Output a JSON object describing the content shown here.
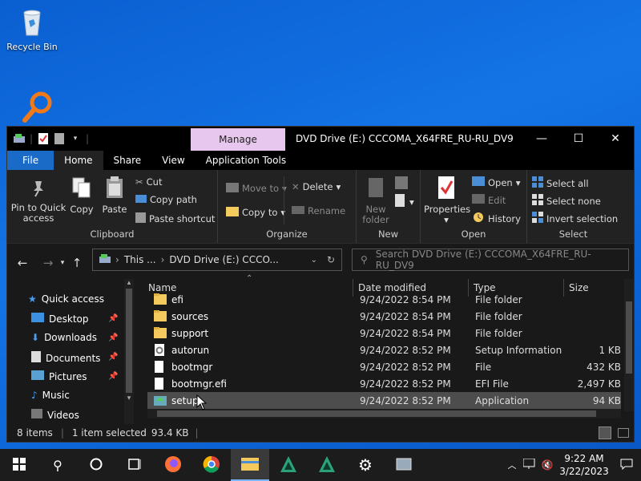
{
  "desktop": {
    "recycle_bin_label": "Recycle Bin"
  },
  "window": {
    "title": "DVD Drive (E:) CCCOMA_X64FRE_RU-RU_DV9",
    "manage_label": "Manage",
    "tabs": [
      "File",
      "Home",
      "Share",
      "View",
      "Application Tools"
    ]
  },
  "ribbon": {
    "clipboard": {
      "pin_label": "Pin to Quick access",
      "copy_label": "Copy",
      "paste_label": "Paste",
      "cut_label": "Cut",
      "copy_path_label": "Copy path",
      "paste_shortcut_label": "Paste shortcut",
      "group_label": "Clipboard"
    },
    "organize": {
      "move_to_label": "Move to",
      "copy_to_label": "Copy to",
      "delete_label": "Delete",
      "rename_label": "Rename",
      "group_label": "Organize"
    },
    "new": {
      "new_folder_label": "New folder",
      "group_label": "New"
    },
    "open": {
      "properties_label": "Properties",
      "open_label": "Open",
      "edit_label": "Edit",
      "history_label": "History",
      "group_label": "Open"
    },
    "select": {
      "select_all_label": "Select all",
      "select_none_label": "Select none",
      "invert_label": "Invert selection",
      "group_label": "Select"
    }
  },
  "address": {
    "this_pc": "This ...",
    "current": "DVD Drive (E:) CCCO...",
    "search_placeholder": "Search DVD Drive (E:) CCCOMA_X64FRE_RU-RU_DV9"
  },
  "nav_pane": {
    "quick_access": "Quick access",
    "items": [
      "Desktop",
      "Downloads",
      "Documents",
      "Pictures",
      "Music",
      "Videos"
    ]
  },
  "columns": {
    "name": "Name",
    "date": "Date modified",
    "type": "Type",
    "size": "Size"
  },
  "files": [
    {
      "name": "efi",
      "date": "9/24/2022 8:54 PM",
      "type": "File folder",
      "size": ""
    },
    {
      "name": "sources",
      "date": "9/24/2022 8:54 PM",
      "type": "File folder",
      "size": ""
    },
    {
      "name": "support",
      "date": "9/24/2022 8:54 PM",
      "type": "File folder",
      "size": ""
    },
    {
      "name": "autorun",
      "date": "9/24/2022 8:52 PM",
      "type": "Setup Information",
      "size": "1 KB"
    },
    {
      "name": "bootmgr",
      "date": "9/24/2022 8:52 PM",
      "type": "File",
      "size": "432 KB"
    },
    {
      "name": "bootmgr.efi",
      "date": "9/24/2022 8:52 PM",
      "type": "EFI File",
      "size": "2,497 KB"
    },
    {
      "name": "setup",
      "date": "9/24/2022 8:52 PM",
      "type": "Application",
      "size": "94 KB"
    }
  ],
  "status": {
    "items_count": "8 items",
    "selected": "1 item selected",
    "selected_size": "93.4 KB"
  },
  "taskbar": {
    "time": "9:22 AM",
    "date": "3/22/2023"
  },
  "colors": {
    "desktop_blue": "#1474e6",
    "file_tab": "#1a6ac8",
    "manage_tab": "#e8c7ef",
    "window_bg": "#191919",
    "folder_yellow": "#f4c95d"
  }
}
